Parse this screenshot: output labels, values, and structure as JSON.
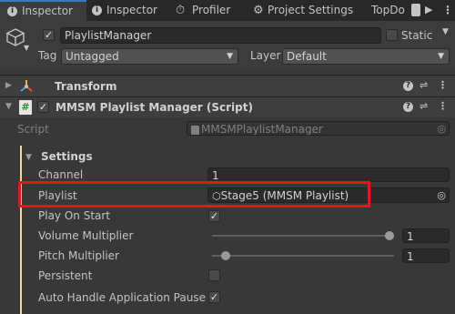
{
  "tabs": [
    {
      "icon": "info-icon",
      "label": "Inspector"
    },
    {
      "icon": "info-icon",
      "label": "Inspector"
    },
    {
      "icon": "stopwatch-icon",
      "label": "Profiler"
    },
    {
      "icon": "gear-icon",
      "label": "Project Settings"
    },
    {
      "icon": "",
      "label": "TopDo"
    }
  ],
  "gameobject": {
    "name": "PlaylistManager",
    "static_label": "Static",
    "tag_label": "Tag",
    "tag_value": "Untagged",
    "layer_label": "Layer",
    "layer_value": "Default",
    "active_checkbox": "✓"
  },
  "components": {
    "transform": {
      "title": "Transform"
    },
    "script_component": {
      "title": "MMSM Playlist Manager (Script)",
      "script_label": "Script",
      "script_value": "MMSMPlaylistManager"
    }
  },
  "settings": {
    "header": "Settings",
    "fields": {
      "channel": {
        "label": "Channel",
        "value": "1"
      },
      "playlist": {
        "label": "Playlist",
        "value": "Stage5 (MMSM Playlist)"
      },
      "play_on_start": {
        "label": "Play On Start",
        "checked": "✓"
      },
      "volume_multiplier": {
        "label": "Volume Multiplier",
        "value": "1",
        "level": 1.0
      },
      "pitch_multiplier": {
        "label": "Pitch Multiplier",
        "value": "1",
        "level": 0.05
      },
      "persistent": {
        "label": "Persistent",
        "checked": ""
      },
      "auto_handle_pause": {
        "label": "Auto Handle Application Pause",
        "checked": "✓"
      }
    }
  },
  "colors": {
    "highlight_box": "#e8141c",
    "accent": "#3a79bb"
  }
}
